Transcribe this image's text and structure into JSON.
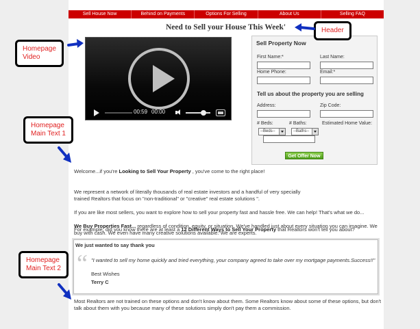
{
  "nav": {
    "items": [
      "Sell House Now",
      "Behind on Payments",
      "Options For Selling",
      "About Us",
      "Selling FAQ"
    ]
  },
  "page": {
    "title": "Need to Sell your House This Week'"
  },
  "video": {
    "elapsed": "00:59",
    "remaining": "00:00"
  },
  "form": {
    "title": "Sell Property Now",
    "first_name_label": "First Name:*",
    "last_name_label": "Last Name:",
    "home_phone_label": "Home Phone:",
    "email_label": "Email:*",
    "property_heading": "Tell us about the property you are selling",
    "address_label": "Address:",
    "zip_label": "Zip Code:",
    "beds_label": "# Beds:",
    "baths_label": "# Baths:",
    "home_value_label": "Estimated Home Value:",
    "beds_select": "--Beds--",
    "baths_select": "--Baths--",
    "submit_label": "Get Offer Now"
  },
  "content": {
    "p1_pre": "Welcome...if you're ",
    "p1_bold": "Looking to Sell Your Property",
    "p1_post": " , you've come to the right place!",
    "p2": "We represent a network of literally thousands of real estate investors and a handful of very specially trained Realtors that focus on \"non-traditional\" or \"creative\" real estate solutions \".",
    "p3": "If you are like most sellers, you want to explore how to sell your property fast and hassle free. We can help! That's what we do...",
    "p4_bold": "We Buy Properties Fast...",
    "p4_post": " regardless of condition, equity, or situation. We've handled just about every situation you can imagine. We buy with cash. We even have many creative solutions available. We are experts.",
    "p5_pre": "For example, did you know there are at least a ",
    "p5_bold": "12 Different Ways to Sell Your Property",
    "p5_post": " that Realtors won't tell you about?",
    "p6": "Most Realtors are not trained on these options and don't know about them. Some Realtors know about some of these options, but don't talk about them with you because many of these solutions simply don't pay them a commission."
  },
  "testimonial": {
    "title": "We just wanted to say thank you",
    "quote": "\"I wanted to sell my home quickly and tried everything, your company agreed to take over my mortgage payments.Success!!\"",
    "wishes": "Best Wishes",
    "name": "Terry C"
  },
  "callouts": {
    "header": "Header",
    "video": "Homepage\nVideo",
    "text1": "Homepage\nMain Text 1",
    "text2": "Homepage\nMain Text 2"
  },
  "colors": {
    "nav_bg": "#cc0000",
    "callout_text": "#e02020",
    "arrow": "#1030c0",
    "button": "#5aa823"
  }
}
